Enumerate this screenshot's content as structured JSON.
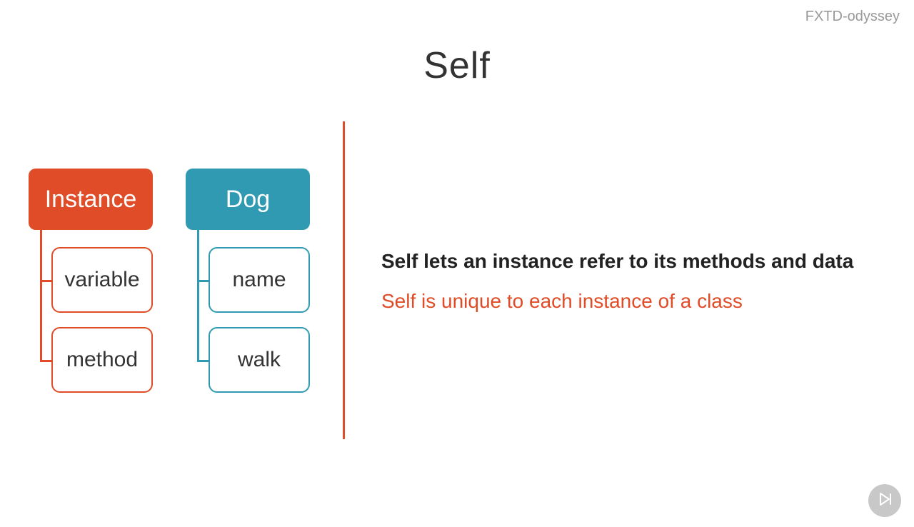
{
  "watermark": "FXTD-odyssey",
  "title": "Self",
  "diagram": {
    "instance": {
      "header": "Instance",
      "child1": "variable",
      "child2": "method",
      "color": "#E04C27"
    },
    "dog": {
      "header": "Dog",
      "child1": "name",
      "child2": "walk",
      "color": "#2F9AB2"
    }
  },
  "text": {
    "line1": "Self lets an instance refer to its methods and data",
    "line2": "Self is unique to each instance of a class"
  }
}
